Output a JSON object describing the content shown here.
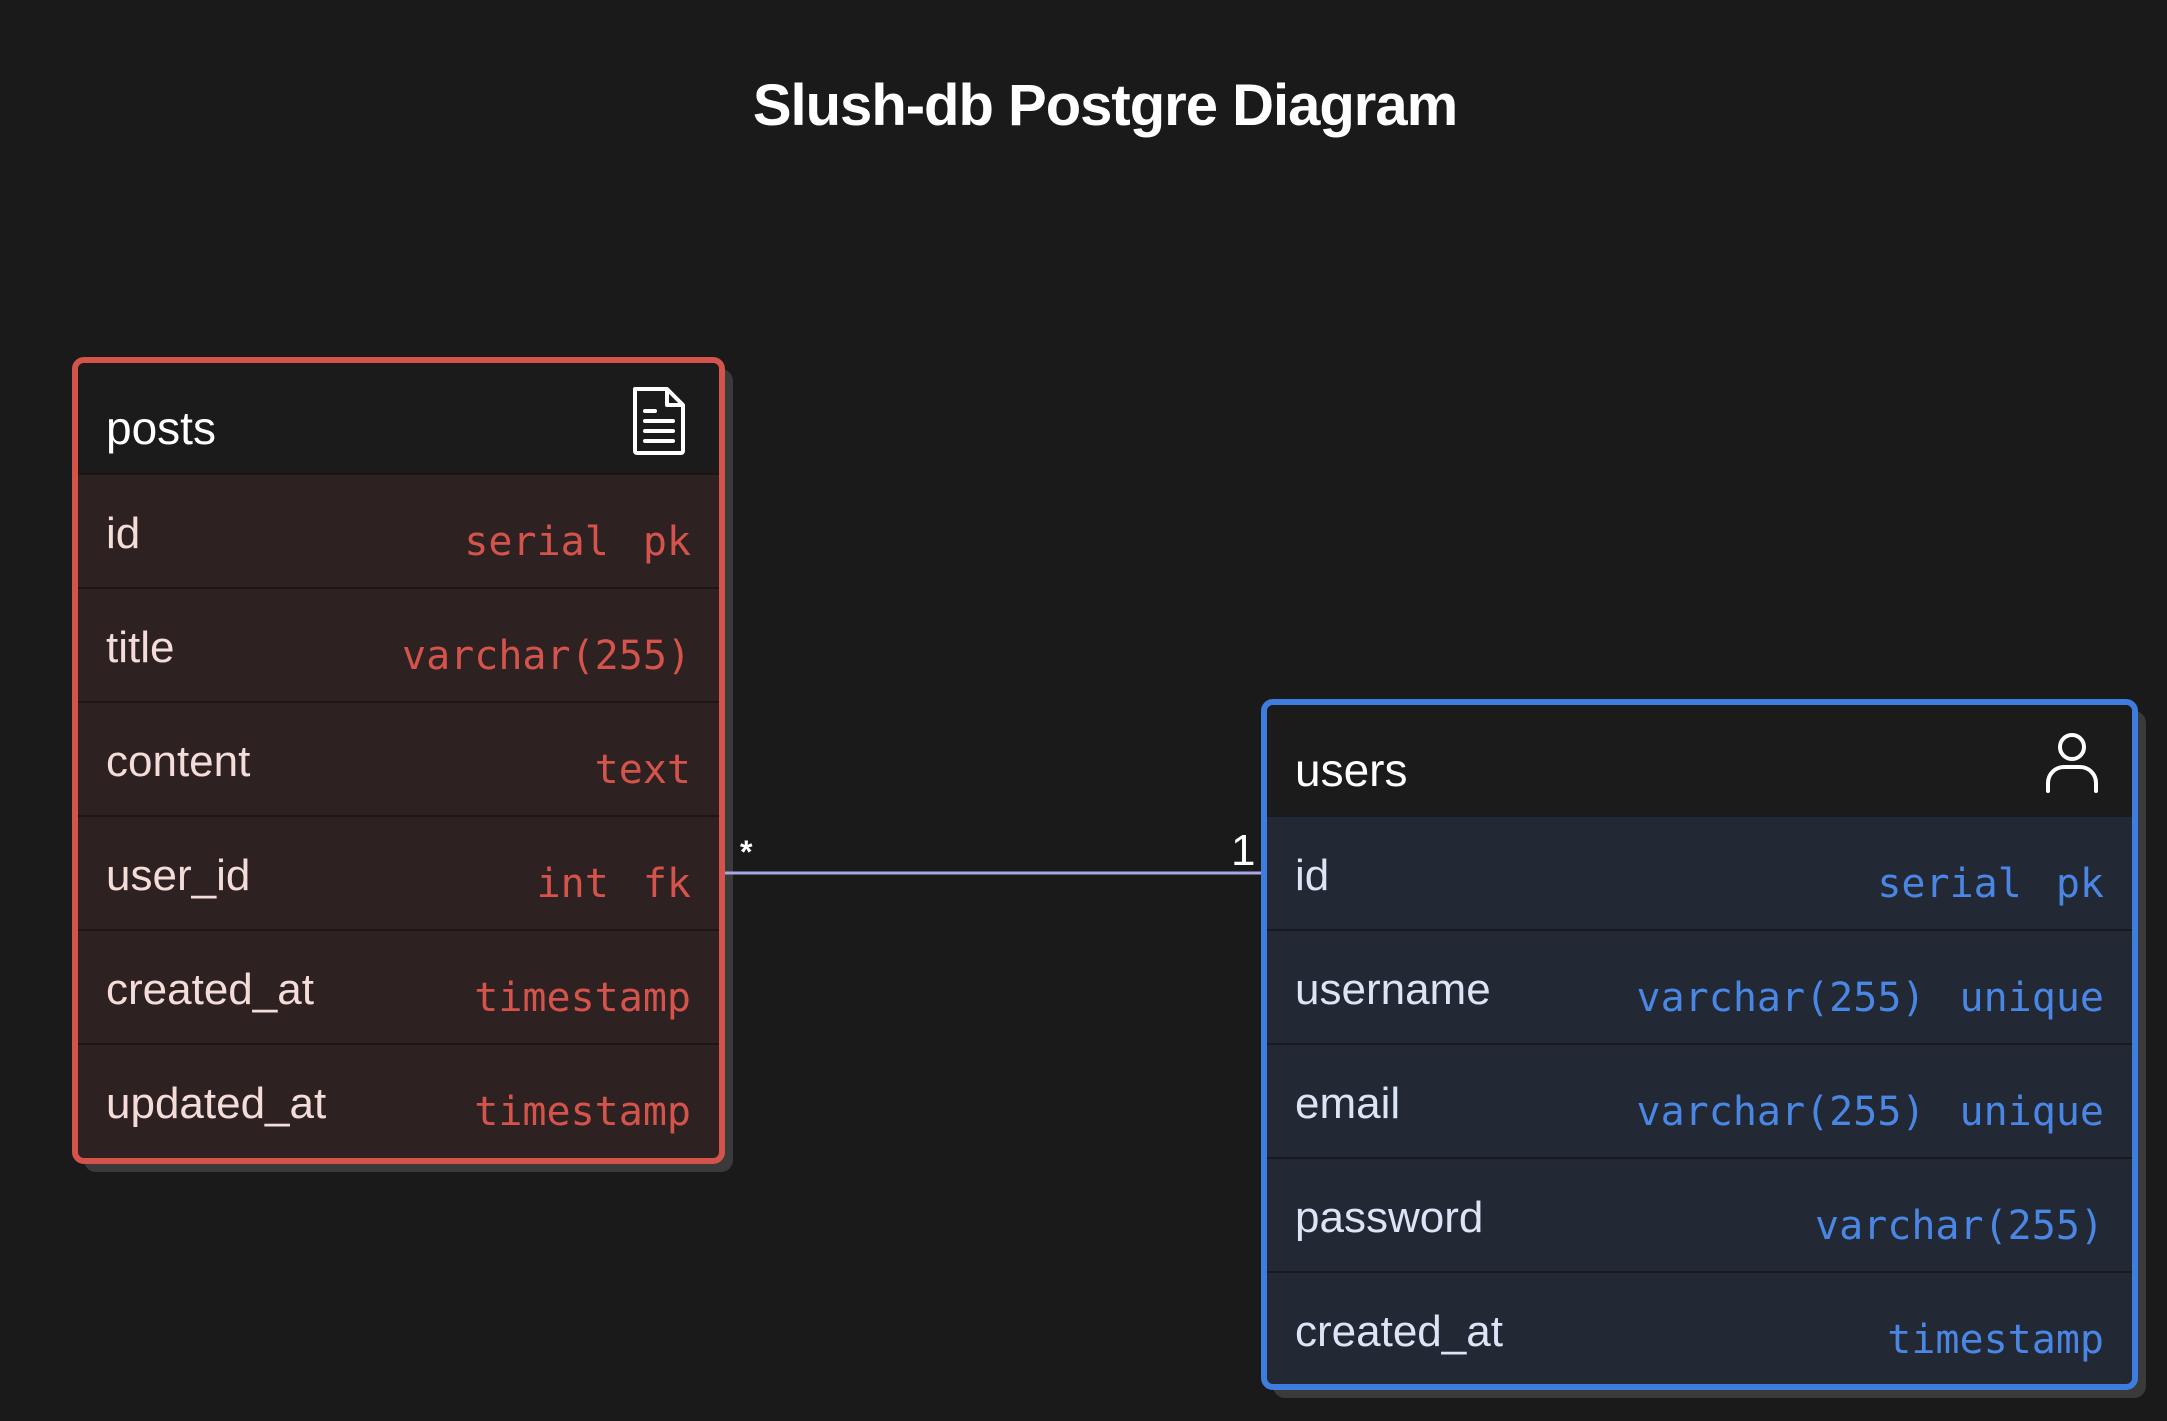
{
  "diagram": {
    "title": "Slush-db Postgre Diagram",
    "colors": {
      "background": "#1a1a1a",
      "posts_accent": "#d4544c",
      "users_accent": "#3f7ce0",
      "relation_line": "#a9a6e6"
    },
    "tables": {
      "posts": {
        "name": "posts",
        "icon": "document-icon",
        "fields": [
          {
            "name": "id",
            "type": "serial",
            "constraint": "pk"
          },
          {
            "name": "title",
            "type": "varchar(255)",
            "constraint": ""
          },
          {
            "name": "content",
            "type": "text",
            "constraint": ""
          },
          {
            "name": "user_id",
            "type": "int",
            "constraint": "fk"
          },
          {
            "name": "created_at",
            "type": "timestamp",
            "constraint": ""
          },
          {
            "name": "updated_at",
            "type": "timestamp",
            "constraint": ""
          }
        ]
      },
      "users": {
        "name": "users",
        "icon": "user-icon",
        "fields": [
          {
            "name": "id",
            "type": "serial",
            "constraint": "pk"
          },
          {
            "name": "username",
            "type": "varchar(255)",
            "constraint": "unique"
          },
          {
            "name": "email",
            "type": "varchar(255)",
            "constraint": "unique"
          },
          {
            "name": "password",
            "type": "varchar(255)",
            "constraint": ""
          },
          {
            "name": "created_at",
            "type": "timestamp",
            "constraint": ""
          }
        ]
      }
    },
    "relationship": {
      "from": "posts.user_id",
      "to": "users.id",
      "from_cardinality": "*",
      "to_cardinality": "1"
    }
  }
}
